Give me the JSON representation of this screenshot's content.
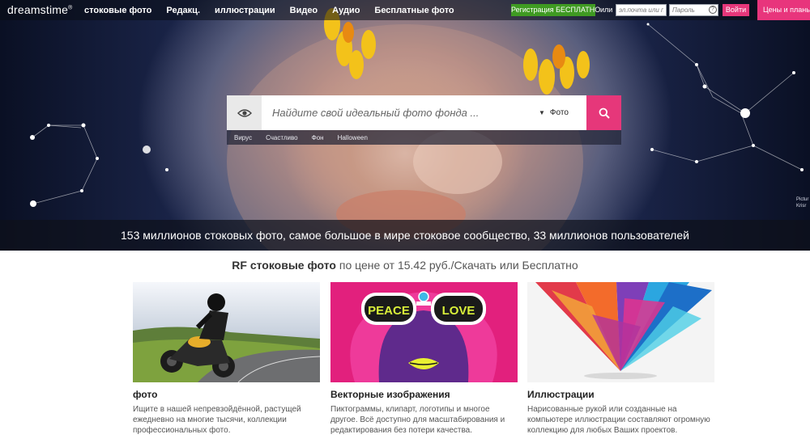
{
  "brand": {
    "logo_text": "dreamstime",
    "logo_mark": "®"
  },
  "nav": {
    "links": [
      "стоковые фото",
      "Редакц.",
      "иллюстрации",
      "Видео",
      "Аудио",
      "Бесплатные фото"
    ],
    "register_label": "Регистрация БЕСПЛАТНО",
    "or_label": "или",
    "email_placeholder": "эл.почта или по",
    "password_placeholder": "Пароль",
    "help_glyph": "?",
    "login_label": "Войти",
    "pricing_label": "Цены и планы с"
  },
  "search": {
    "placeholder": "Найдите свой идеальный фото фонда ...",
    "type_selected": "Фото",
    "tags": [
      "Вирус",
      "Счастливо",
      "Фон",
      "Halloween"
    ],
    "accent_color": "#e6377a"
  },
  "hero": {
    "credit_line1": "Pictur",
    "credit_line2": "Krisr",
    "stats": "153 миллионов стоковых фото, самое большое в мире стоковое сообщество, 33 миллионов пользователей"
  },
  "headline": {
    "bold": "RF стоковые фото",
    "rest": " по цене от 15.42 руб./Скачать или Бесплатно"
  },
  "cards": [
    {
      "title": "фото",
      "desc": "Ищите в нашей непревзойдённой, растущей ежедневно на многие тысячи, коллекции профессиональных фото."
    },
    {
      "title": "Векторные изображения",
      "desc": "Пиктограммы, клипарт, логотипы и многое другое. Всё доступно для масштабирования и редактирования без потери качества.",
      "art_text_1": "PEACE",
      "art_text_2": "LOVE"
    },
    {
      "title": "Иллюстрации",
      "desc": "Нарисованные рукой или созданные на компьютере иллюстрации составляют огромную коллекцию для любых Ваших проектов."
    }
  ]
}
